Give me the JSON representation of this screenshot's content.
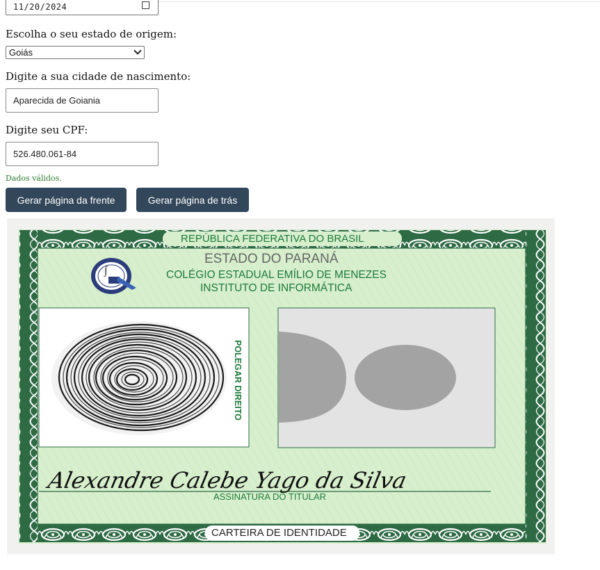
{
  "form": {
    "date_value": "11/20/2024",
    "state_label": "Escolha o seu estado de origem:",
    "state_selected": "Goiás",
    "city_label": "Digite a sua cidade de nascimento:",
    "city_value": "Aparecida de Goiania",
    "cpf_label": "Digite seu CPF:",
    "cpf_value": "526.480.061-84",
    "validation_message": "Dados válidos.",
    "front_button": "Gerar página da frente",
    "back_button": "Gerar página de trás"
  },
  "card": {
    "header": "REPÚBLICA FEDERATIVA DO BRASIL",
    "state": "ESTADO DO PARANÁ",
    "school": "COLÉGIO ESTADUAL EMÍLIO DE MENEZES",
    "institute": "INSTITUTO DE INFORMÁTICA",
    "thumb_label": "POLEGAR DIREITO",
    "signature": "Alexandre Calebe Yago da Silva",
    "signature_label": "ASSINATURA DO TITULAR",
    "footer": "CARTEIRA DE IDENTIDADE",
    "colors": {
      "border_green": "#2e6b45",
      "text_green": "#1e7a3c",
      "background_green": "#d7efcc",
      "button_bg": "#33475b"
    },
    "icons": [
      "school-seal-icon",
      "fingerprint-icon",
      "photo-placeholder-icon"
    ]
  }
}
